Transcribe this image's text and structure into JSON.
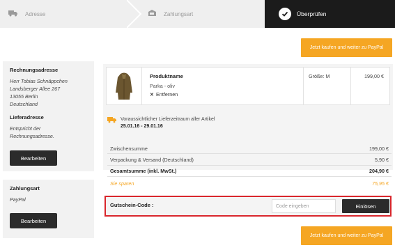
{
  "stepper": {
    "steps": [
      {
        "label": "Adresse",
        "icon": "truck-icon"
      },
      {
        "label": "Zahlungsart",
        "icon": "wallet-icon"
      },
      {
        "label": "Überprüfen",
        "icon": "check-circle-icon"
      }
    ],
    "active_index": 2
  },
  "actions": {
    "paypal_label": "Jetzt kaufen und weiter zu PayPal"
  },
  "billing": {
    "title": "Rechnungsadresse",
    "lines": [
      "Herr Tobias Schnäppchen",
      "Landsberger Allee 267",
      "13055 Berlin",
      "Deutschland"
    ]
  },
  "delivery_address": {
    "title": "Lieferadresse",
    "lines": [
      "Entspricht der",
      "Rechnungsadresse."
    ],
    "edit_label": "Bearbeiten"
  },
  "payment": {
    "title": "Zahlungsart",
    "method": "PayPal",
    "edit_label": "Bearbeiten"
  },
  "product": {
    "name": "Produktname",
    "variant": "Parka - oliv",
    "remove_label": "Entfernen",
    "size": "Größe: M",
    "price": "199,00 €"
  },
  "shipping_info": {
    "text": "Voraussichtlicher Lieferzeitraum aller Artikel",
    "dates": "25.01.16 - 29.01.16"
  },
  "summary": {
    "subtotal_label": "Zwischensumme",
    "subtotal_value": "199,00 €",
    "shipping_label": "Verpackung & Versand (Deutschland)",
    "shipping_value": "5,90 €",
    "total_label": "Gesamtsumme (inkl. MwSt.)",
    "total_value": "204,90 €",
    "savings_label": "Sie sparen",
    "savings_value": "75,95 €"
  },
  "voucher": {
    "label": "Gutschein-Code :",
    "placeholder": "Code eingeben",
    "button_label": "Einlösen"
  },
  "colors": {
    "accent": "#f5a623",
    "dark": "#2b2b2b",
    "highlight": "#d9262c"
  }
}
